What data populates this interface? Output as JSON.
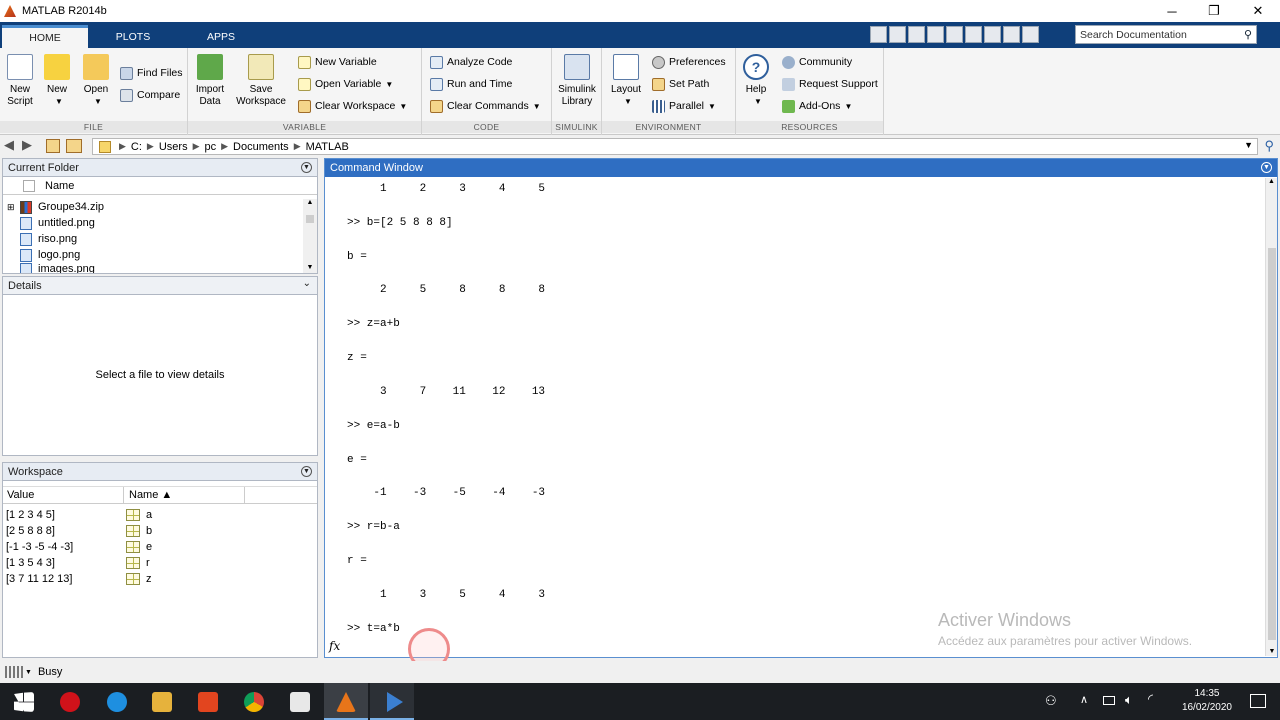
{
  "window": {
    "title": "MATLAB R2014b"
  },
  "tabs": [
    {
      "label": "HOME"
    },
    {
      "label": "PLOTS"
    },
    {
      "label": "APPS"
    }
  ],
  "search": {
    "placeholder": "Search Documentation"
  },
  "ribbon": {
    "file": {
      "label": "FILE",
      "new_script": "New\nScript",
      "new": "New",
      "open": "Open",
      "find_files": "Find Files",
      "compare": "Compare"
    },
    "variable": {
      "label": "VARIABLE",
      "import_data": "Import\nData",
      "save_workspace": "Save\nWorkspace",
      "new_variable": "New Variable",
      "open_variable": "Open Variable",
      "clear_workspace": "Clear Workspace"
    },
    "code": {
      "label": "CODE",
      "analyze_code": "Analyze Code",
      "run_and_time": "Run and Time",
      "clear_commands": "Clear Commands"
    },
    "simulink": {
      "label": "SIMULINK",
      "simulink_library": "Simulink\nLibrary"
    },
    "environment": {
      "label": "ENVIRONMENT",
      "layout": "Layout",
      "preferences": "Preferences",
      "set_path": "Set Path",
      "parallel": "Parallel"
    },
    "resources": {
      "label": "RESOURCES",
      "help": "Help",
      "community": "Community",
      "request_support": "Request Support",
      "add_ons": "Add-Ons"
    }
  },
  "address": {
    "crumbs": [
      "C:",
      "Users",
      "pc",
      "Documents",
      "MATLAB"
    ]
  },
  "current_folder": {
    "title": "Current Folder",
    "column": "Name",
    "files": [
      "Groupe34.zip",
      "untitled.png",
      "riso.png",
      "logo.png",
      "images.png"
    ]
  },
  "details": {
    "title": "Details",
    "message": "Select a file to view details"
  },
  "workspace": {
    "title": "Workspace",
    "col_value": "Value",
    "col_name": "Name ▲",
    "vars": [
      {
        "value": "[1 2 3 4 5]",
        "name": "a"
      },
      {
        "value": "[2 5 8 8 8]",
        "name": "b"
      },
      {
        "value": "[-1 -3 -5 -4 -3]",
        "name": "e"
      },
      {
        "value": "[1 3 5 4 3]",
        "name": "r"
      },
      {
        "value": "[3 7 11 12 13]",
        "name": "z"
      }
    ]
  },
  "command_window": {
    "title": "Command Window",
    "lines": [
      "     1     2     3     4     5",
      "",
      ">> b=[2 5 8 8 8]",
      "",
      "b =",
      "",
      "     2     5     8     8     8",
      "",
      ">> z=a+b",
      "",
      "z =",
      "",
      "     3     7    11    12    13",
      "",
      ">> e=a-b",
      "",
      "e =",
      "",
      "    -1    -3    -5    -4    -3",
      "",
      ">> r=b-a",
      "",
      "r =",
      "",
      "     1     3     5     4     3",
      "",
      ">> t=a*b"
    ],
    "fx": "fx"
  },
  "status": {
    "text": "Busy"
  },
  "watermark": {
    "line1": "Activer Windows",
    "line2": "Accédez aux paramètres pour activer Windows."
  },
  "clock": {
    "time": "14:35",
    "date": "16/02/2020"
  }
}
